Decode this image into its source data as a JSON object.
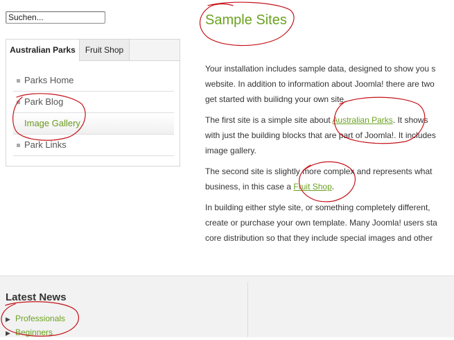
{
  "search": {
    "value": "Suchen..."
  },
  "tabs": [
    {
      "label": "Australian Parks"
    },
    {
      "label": "Fruit Shop"
    }
  ],
  "menu": {
    "items": [
      {
        "label": "Parks Home"
      },
      {
        "label": "Park Blog"
      },
      {
        "label": "Image Gallery",
        "active": true
      },
      {
        "label": "Park Links"
      }
    ]
  },
  "main": {
    "title": "Sample Sites",
    "p1_l1": "Your installation includes sample data, designed to show you s",
    "p1_l2": "website. In addition to information about Joomla! there are two",
    "p1_l3": "get started with builidng your own site.",
    "p2_l1_pre": "The first site is a simple site about ",
    "p2_link": "Australian Parks",
    "p2_l1_post": ". It shows",
    "p2_l2": "with just the building blocks that are part of Joomla!. It includes",
    "p2_l3": "image gallery.",
    "p3_l1": "The second site is slightly more complex and represents what",
    "p3_l2_pre": "business, in this case a ",
    "p3_link": "Fruit Shop",
    "p3_l2_post": ".",
    "p4_l1": "In building either style site, or something completely different,",
    "p4_l2": "create or purchase your own template. Many Joomla! users sta",
    "p4_l3": "core distribution so that they include special images and other"
  },
  "footer": {
    "news_title": "Latest News",
    "news_items": [
      {
        "label": "Professionals"
      },
      {
        "label": "Beginners"
      }
    ]
  },
  "colors": {
    "accent_green": "#6aa21f",
    "annotation_red": "#c4121a"
  }
}
